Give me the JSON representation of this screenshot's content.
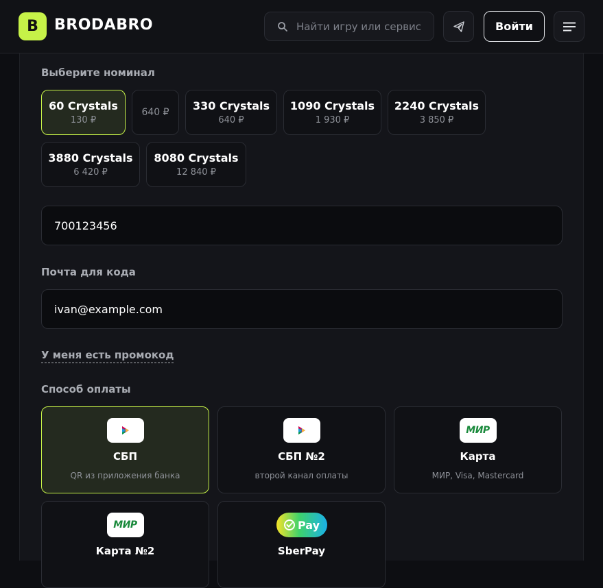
{
  "header": {
    "logo_letter": "B",
    "brand": "BRODABRO",
    "search_placeholder": "Найти игру или сервис",
    "login_label": "Войти"
  },
  "nominal": {
    "label": "Выберите номинал",
    "items": [
      {
        "name": "60 Crystals",
        "price": "130 ₽",
        "selected": true
      },
      {
        "name": "",
        "price": "640 ₽",
        "selected": false
      },
      {
        "name": "330 Crystals",
        "price": "640 ₽",
        "selected": false
      },
      {
        "name": "1090 Crystals",
        "price": "1 930 ₽",
        "selected": false
      },
      {
        "name": "2240 Crystals",
        "price": "3 850 ₽",
        "selected": false
      },
      {
        "name": "3880 Crystals",
        "price": "6 420 ₽",
        "selected": false
      },
      {
        "name": "8080 Crystals",
        "price": "12 840 ₽",
        "selected": false
      }
    ]
  },
  "player_id": {
    "value": "700123456"
  },
  "email": {
    "label": "Почта для кода",
    "value": "ivan@example.com"
  },
  "promo": {
    "label": "У меня есть промокод"
  },
  "payment": {
    "label": "Способ оплаты",
    "methods": [
      {
        "name": "СБП",
        "desc": "QR из приложения банка",
        "logo": "sbp-logo",
        "selected": true
      },
      {
        "name": "СБП №2",
        "desc": "второй канал оплаты",
        "logo": "sbp-logo",
        "selected": false
      },
      {
        "name": "Карта",
        "desc": "МИР, Visa, Mastercard",
        "logo": "mir-logo",
        "logo_text": "МИР",
        "selected": false
      },
      {
        "name": "Карта №2",
        "desc": "",
        "logo": "mir-logo",
        "logo_text": "МИР",
        "selected": false
      },
      {
        "name": "SberPay",
        "desc": "",
        "logo": "sberpay-logo",
        "logo_text": "Pay",
        "selected": false
      }
    ]
  },
  "colors": {
    "accent": "#c6f248",
    "background": "#0d0e12",
    "card": "#14151a"
  }
}
